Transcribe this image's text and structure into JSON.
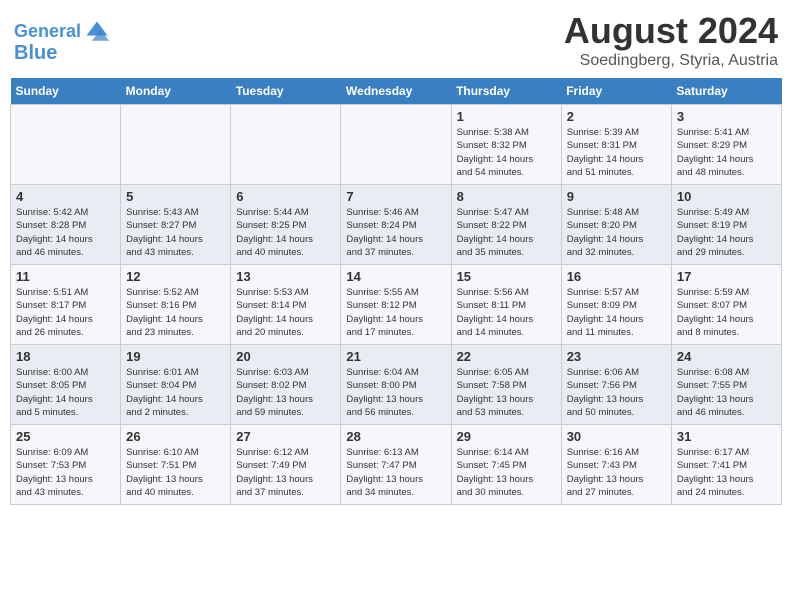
{
  "header": {
    "logo_line1": "General",
    "logo_line2": "Blue",
    "month_year": "August 2024",
    "location": "Soedingberg, Styria, Austria"
  },
  "weekdays": [
    "Sunday",
    "Monday",
    "Tuesday",
    "Wednesday",
    "Thursday",
    "Friday",
    "Saturday"
  ],
  "weeks": [
    [
      {
        "day": "",
        "info": ""
      },
      {
        "day": "",
        "info": ""
      },
      {
        "day": "",
        "info": ""
      },
      {
        "day": "",
        "info": ""
      },
      {
        "day": "1",
        "info": "Sunrise: 5:38 AM\nSunset: 8:32 PM\nDaylight: 14 hours\nand 54 minutes."
      },
      {
        "day": "2",
        "info": "Sunrise: 5:39 AM\nSunset: 8:31 PM\nDaylight: 14 hours\nand 51 minutes."
      },
      {
        "day": "3",
        "info": "Sunrise: 5:41 AM\nSunset: 8:29 PM\nDaylight: 14 hours\nand 48 minutes."
      }
    ],
    [
      {
        "day": "4",
        "info": "Sunrise: 5:42 AM\nSunset: 8:28 PM\nDaylight: 14 hours\nand 46 minutes."
      },
      {
        "day": "5",
        "info": "Sunrise: 5:43 AM\nSunset: 8:27 PM\nDaylight: 14 hours\nand 43 minutes."
      },
      {
        "day": "6",
        "info": "Sunrise: 5:44 AM\nSunset: 8:25 PM\nDaylight: 14 hours\nand 40 minutes."
      },
      {
        "day": "7",
        "info": "Sunrise: 5:46 AM\nSunset: 8:24 PM\nDaylight: 14 hours\nand 37 minutes."
      },
      {
        "day": "8",
        "info": "Sunrise: 5:47 AM\nSunset: 8:22 PM\nDaylight: 14 hours\nand 35 minutes."
      },
      {
        "day": "9",
        "info": "Sunrise: 5:48 AM\nSunset: 8:20 PM\nDaylight: 14 hours\nand 32 minutes."
      },
      {
        "day": "10",
        "info": "Sunrise: 5:49 AM\nSunset: 8:19 PM\nDaylight: 14 hours\nand 29 minutes."
      }
    ],
    [
      {
        "day": "11",
        "info": "Sunrise: 5:51 AM\nSunset: 8:17 PM\nDaylight: 14 hours\nand 26 minutes."
      },
      {
        "day": "12",
        "info": "Sunrise: 5:52 AM\nSunset: 8:16 PM\nDaylight: 14 hours\nand 23 minutes."
      },
      {
        "day": "13",
        "info": "Sunrise: 5:53 AM\nSunset: 8:14 PM\nDaylight: 14 hours\nand 20 minutes."
      },
      {
        "day": "14",
        "info": "Sunrise: 5:55 AM\nSunset: 8:12 PM\nDaylight: 14 hours\nand 17 minutes."
      },
      {
        "day": "15",
        "info": "Sunrise: 5:56 AM\nSunset: 8:11 PM\nDaylight: 14 hours\nand 14 minutes."
      },
      {
        "day": "16",
        "info": "Sunrise: 5:57 AM\nSunset: 8:09 PM\nDaylight: 14 hours\nand 11 minutes."
      },
      {
        "day": "17",
        "info": "Sunrise: 5:59 AM\nSunset: 8:07 PM\nDaylight: 14 hours\nand 8 minutes."
      }
    ],
    [
      {
        "day": "18",
        "info": "Sunrise: 6:00 AM\nSunset: 8:05 PM\nDaylight: 14 hours\nand 5 minutes."
      },
      {
        "day": "19",
        "info": "Sunrise: 6:01 AM\nSunset: 8:04 PM\nDaylight: 14 hours\nand 2 minutes."
      },
      {
        "day": "20",
        "info": "Sunrise: 6:03 AM\nSunset: 8:02 PM\nDaylight: 13 hours\nand 59 minutes."
      },
      {
        "day": "21",
        "info": "Sunrise: 6:04 AM\nSunset: 8:00 PM\nDaylight: 13 hours\nand 56 minutes."
      },
      {
        "day": "22",
        "info": "Sunrise: 6:05 AM\nSunset: 7:58 PM\nDaylight: 13 hours\nand 53 minutes."
      },
      {
        "day": "23",
        "info": "Sunrise: 6:06 AM\nSunset: 7:56 PM\nDaylight: 13 hours\nand 50 minutes."
      },
      {
        "day": "24",
        "info": "Sunrise: 6:08 AM\nSunset: 7:55 PM\nDaylight: 13 hours\nand 46 minutes."
      }
    ],
    [
      {
        "day": "25",
        "info": "Sunrise: 6:09 AM\nSunset: 7:53 PM\nDaylight: 13 hours\nand 43 minutes."
      },
      {
        "day": "26",
        "info": "Sunrise: 6:10 AM\nSunset: 7:51 PM\nDaylight: 13 hours\nand 40 minutes."
      },
      {
        "day": "27",
        "info": "Sunrise: 6:12 AM\nSunset: 7:49 PM\nDaylight: 13 hours\nand 37 minutes."
      },
      {
        "day": "28",
        "info": "Sunrise: 6:13 AM\nSunset: 7:47 PM\nDaylight: 13 hours\nand 34 minutes."
      },
      {
        "day": "29",
        "info": "Sunrise: 6:14 AM\nSunset: 7:45 PM\nDaylight: 13 hours\nand 30 minutes."
      },
      {
        "day": "30",
        "info": "Sunrise: 6:16 AM\nSunset: 7:43 PM\nDaylight: 13 hours\nand 27 minutes."
      },
      {
        "day": "31",
        "info": "Sunrise: 6:17 AM\nSunset: 7:41 PM\nDaylight: 13 hours\nand 24 minutes."
      }
    ]
  ]
}
